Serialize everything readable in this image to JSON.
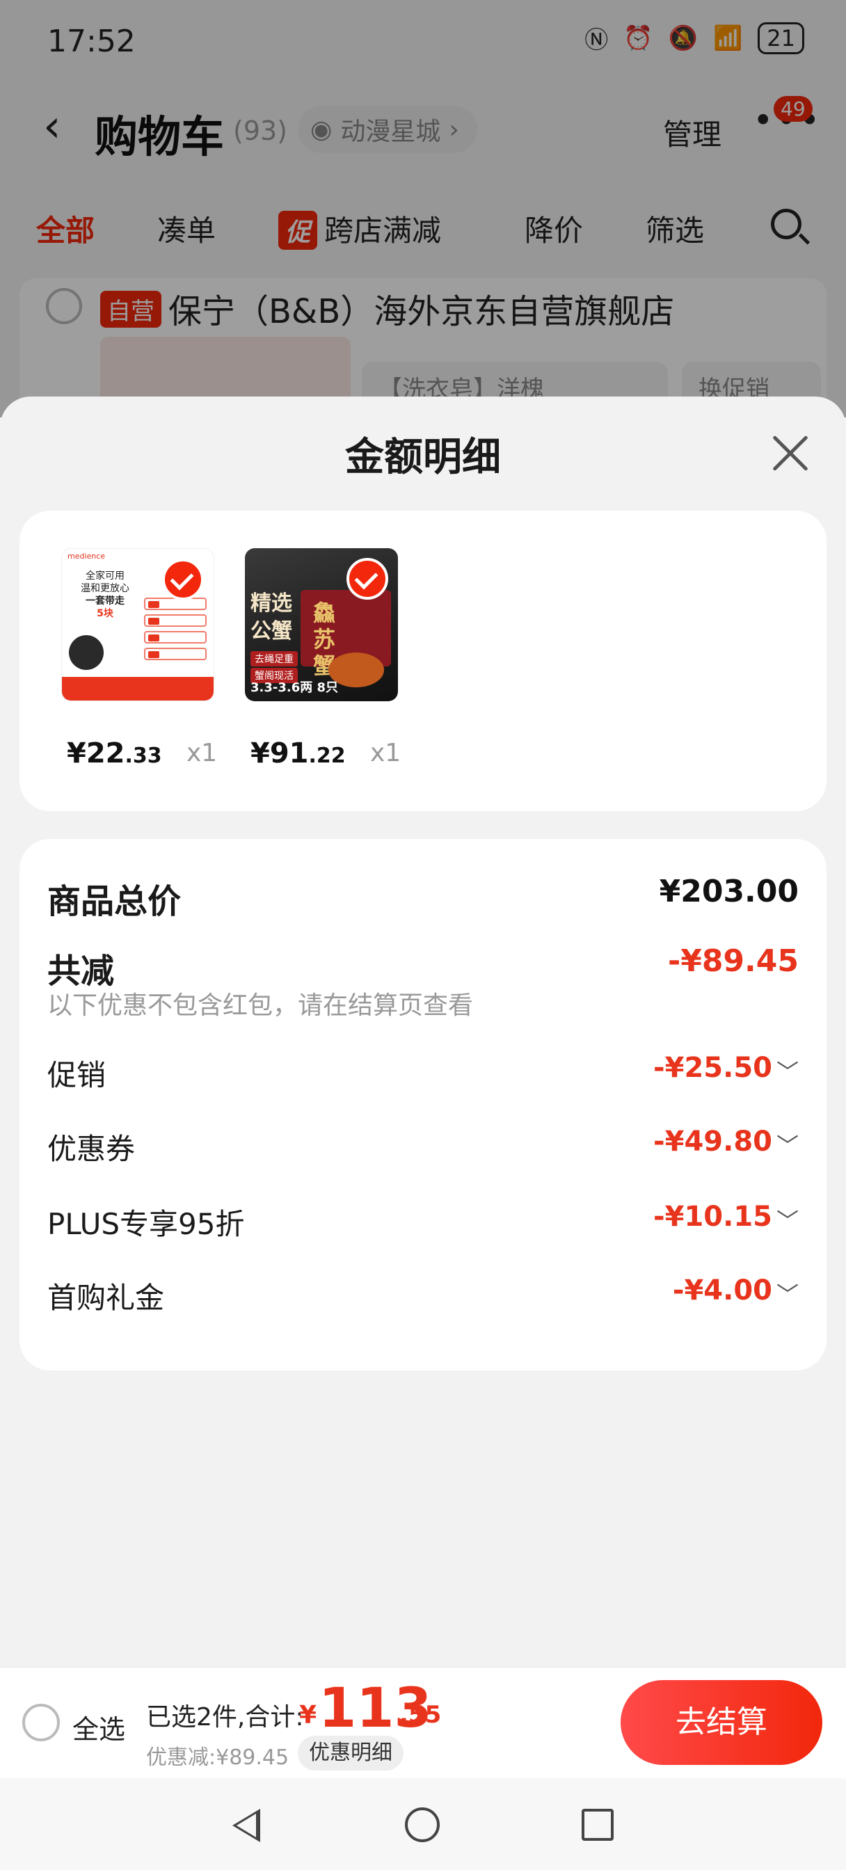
{
  "status_bar": {
    "time": "17:52",
    "battery": "21"
  },
  "nav": {
    "title": "购物车",
    "count": "(93)",
    "store": "动漫星城",
    "manage": "管理",
    "badge": "49"
  },
  "tabs": [
    {
      "label": "全部"
    },
    {
      "label": "凑单"
    },
    {
      "label": "跨店满减",
      "tag": "促"
    },
    {
      "label": "降价"
    },
    {
      "label": "筛选"
    }
  ],
  "shop": {
    "self_tag": "自营",
    "name": "保宁（B&B）海外京东自营旗舰店",
    "option1": "【洗衣皂】洋槐",
    "option2": "换促销"
  },
  "sheet": {
    "title": "金额明细",
    "products": [
      {
        "price_int": "¥22",
        "price_dec": ".33",
        "qty": "x1",
        "image_text": {
          "brand": "medience",
          "line1": "全家可用",
          "line2": "温和更放心",
          "line3": "一套带走",
          "line4": "5块"
        }
      },
      {
        "price_int": "¥91",
        "price_dec": ".22",
        "qty": "x1",
        "image_text": {
          "title": "精选公蟹",
          "box": "鱻苏蟹",
          "tag1": "去绳足重",
          "tag2": "蟹阁现活",
          "caption": "3.3-3.6两 8只"
        }
      }
    ],
    "summary": {
      "total_label": "商品总价",
      "total_value": "¥203.00",
      "reduce_label": "共减",
      "reduce_value": "-¥89.45",
      "note": "以下优惠不包含红包，请在结算页查看",
      "items": [
        {
          "label": "促销",
          "value": "-¥25.50"
        },
        {
          "label": "优惠券",
          "value": "-¥49.80"
        },
        {
          "label": "PLUS专享95折",
          "value": "-¥10.15"
        },
        {
          "label": "首购礼金",
          "value": "-¥4.00"
        }
      ]
    }
  },
  "bottom": {
    "select_all": "全选",
    "selected": "已选2件,合计:",
    "total_symbol": "¥",
    "total_int": "113",
    "total_dec": ".55",
    "discount": "优惠减:¥89.45",
    "detail": "优惠明细",
    "checkout": "去结算"
  },
  "colors": {
    "accent": "#f2270c",
    "price_red": "#e8341c",
    "muted": "#999999"
  }
}
